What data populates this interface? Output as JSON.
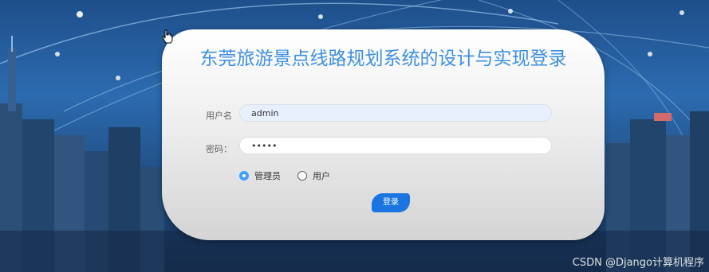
{
  "login": {
    "title": "东莞旅游景点线路规划系统的设计与实现登录",
    "username_label": "用户名",
    "username_value": "admin",
    "password_label": "密码：",
    "password_value": "•••••",
    "roles": [
      {
        "label": "管理员",
        "checked": true
      },
      {
        "label": "用户",
        "checked": false
      }
    ],
    "submit_label": "登录"
  },
  "watermark": "CSDN @Django计算机程序",
  "colors": {
    "title": "#3d8fe0",
    "accent": "#409eff",
    "button": "#1b75e0"
  }
}
